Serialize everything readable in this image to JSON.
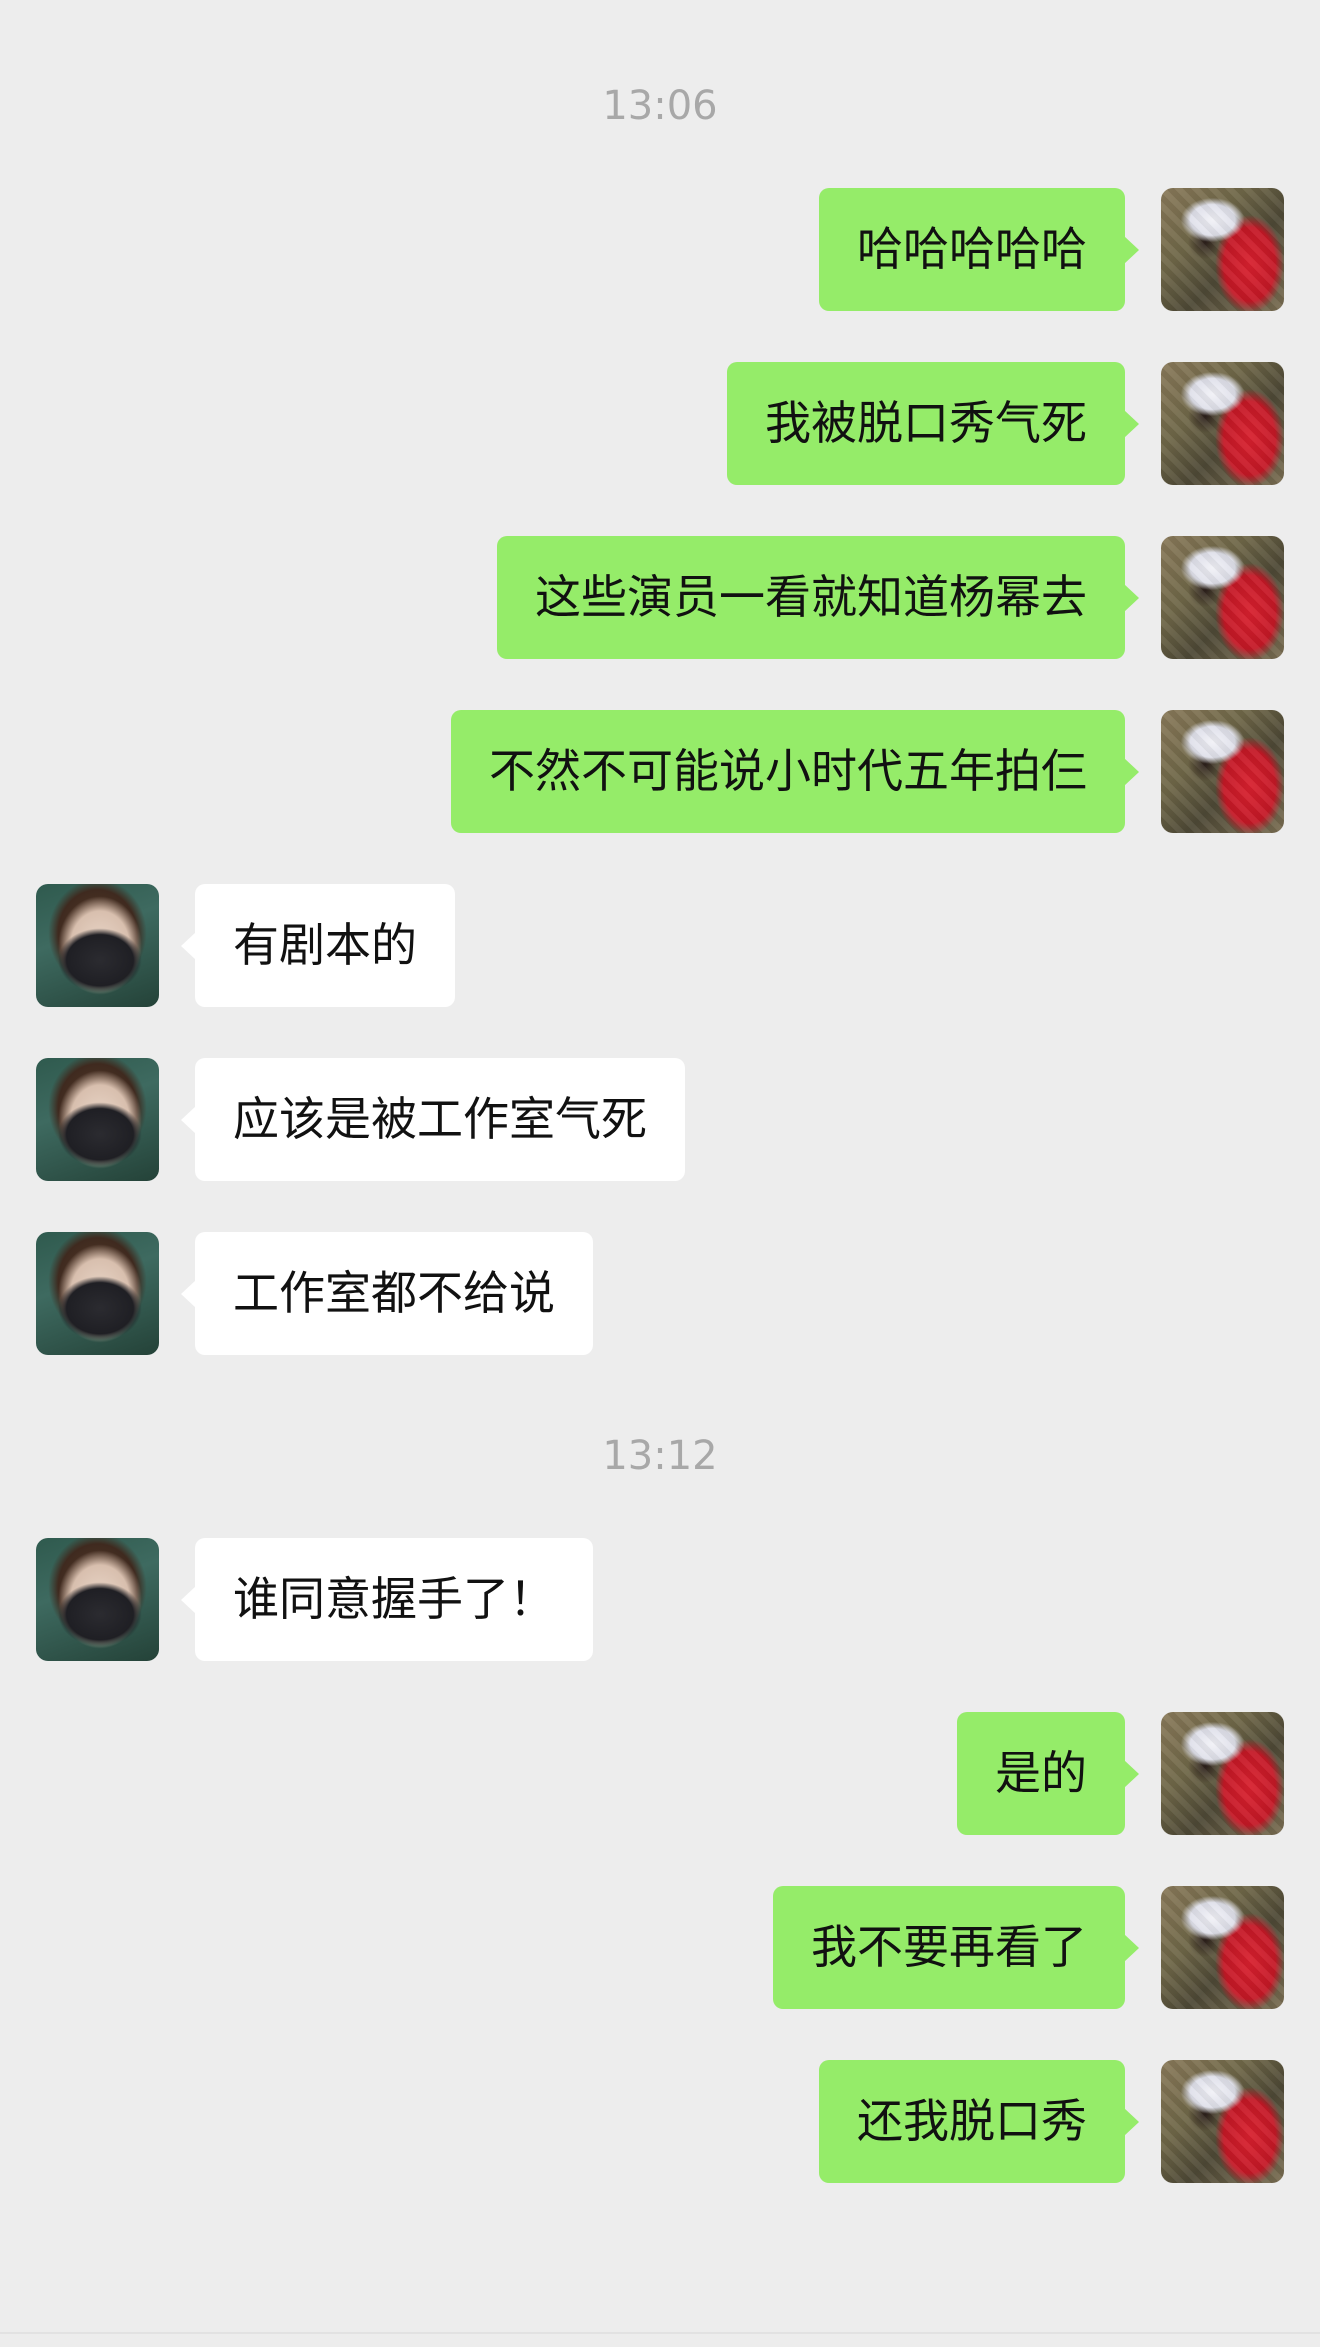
{
  "chat": {
    "timestamps": [
      "13:06",
      "13:12"
    ],
    "messages": [
      {
        "side": "right",
        "text": "哈哈哈哈哈"
      },
      {
        "side": "right",
        "text": "我被脱口秀气死"
      },
      {
        "side": "right",
        "text": "这些演员一看就知道杨幂去"
      },
      {
        "side": "right",
        "text": "不然不可能说小时代五年拍仨"
      },
      {
        "side": "left",
        "text": "有剧本的"
      },
      {
        "side": "left",
        "text": "应该是被工作室气死"
      },
      {
        "side": "left",
        "text": "工作室都不给说"
      },
      {
        "side": "left",
        "text": "谁同意握手了！"
      },
      {
        "side": "right",
        "text": "是的"
      },
      {
        "side": "right",
        "text": "我不要再看了"
      },
      {
        "side": "right",
        "text": "还我脱口秀"
      }
    ]
  },
  "colors": {
    "background": "#ededed",
    "outgoing_bubble": "#95ec69",
    "incoming_bubble": "#ffffff",
    "timestamp_text": "#a8a8a8"
  }
}
